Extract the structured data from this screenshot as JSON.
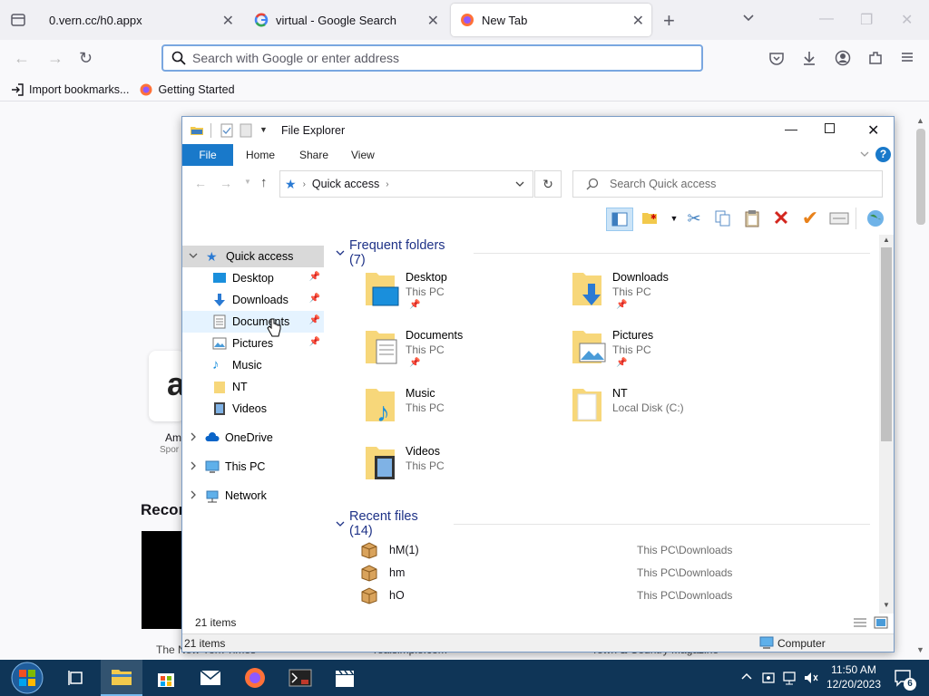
{
  "browser": {
    "tabs": [
      {
        "title": "0.vern.cc/h0.appx",
        "active": false
      },
      {
        "title": "virtual - Google Search",
        "active": false
      },
      {
        "title": "New Tab",
        "active": true
      }
    ],
    "urlbar_placeholder": "Search with Google or enter address",
    "bookmarks": [
      {
        "label": "Import bookmarks..."
      },
      {
        "label": "Getting Started"
      }
    ],
    "background": {
      "shortcut_label": "Am",
      "shortcut_sub": "Spor",
      "section_heading": "Recon",
      "story_1": "The New York Times",
      "story_2": "realsimple.com",
      "story_3": "Town & Country Magazine"
    }
  },
  "explorer": {
    "title": "File Explorer",
    "ribbon_tabs": [
      "File",
      "Home",
      "Share",
      "View"
    ],
    "address": {
      "root": "Quick access"
    },
    "search_placeholder": "Search Quick access",
    "nav": {
      "quick_access": "Quick access",
      "items": [
        {
          "label": "Desktop",
          "pinned": true
        },
        {
          "label": "Downloads",
          "pinned": true
        },
        {
          "label": "Documents",
          "pinned": true
        },
        {
          "label": "Pictures",
          "pinned": true
        },
        {
          "label": "Music",
          "pinned": false
        },
        {
          "label": "NT",
          "pinned": false
        },
        {
          "label": "Videos",
          "pinned": false
        }
      ],
      "roots": [
        "OneDrive",
        "This PC",
        "Network"
      ]
    },
    "frequent_heading": "Frequent folders (7)",
    "frequent": [
      {
        "name": "Desktop",
        "location": "This PC",
        "pinned": true
      },
      {
        "name": "Downloads",
        "location": "This PC",
        "pinned": true
      },
      {
        "name": "Documents",
        "location": "This PC",
        "pinned": true
      },
      {
        "name": "Pictures",
        "location": "This PC",
        "pinned": true
      },
      {
        "name": "Music",
        "location": "This PC",
        "pinned": false
      },
      {
        "name": "NT",
        "location": "Local Disk (C:)",
        "pinned": false
      },
      {
        "name": "Videos",
        "location": "This PC",
        "pinned": false
      }
    ],
    "recent_heading": "Recent files (14)",
    "recent": [
      {
        "name": "hM(1)",
        "path": "This PC\\Downloads"
      },
      {
        "name": "hm",
        "path": "This PC\\Downloads"
      },
      {
        "name": "hO",
        "path": "This PC\\Downloads"
      }
    ],
    "status_items": "21 items",
    "status2_items": "21 items",
    "status2_location": "Computer"
  },
  "taskbar": {
    "time": "11:50 AM",
    "date": "12/20/2023",
    "notification_count": "6"
  }
}
